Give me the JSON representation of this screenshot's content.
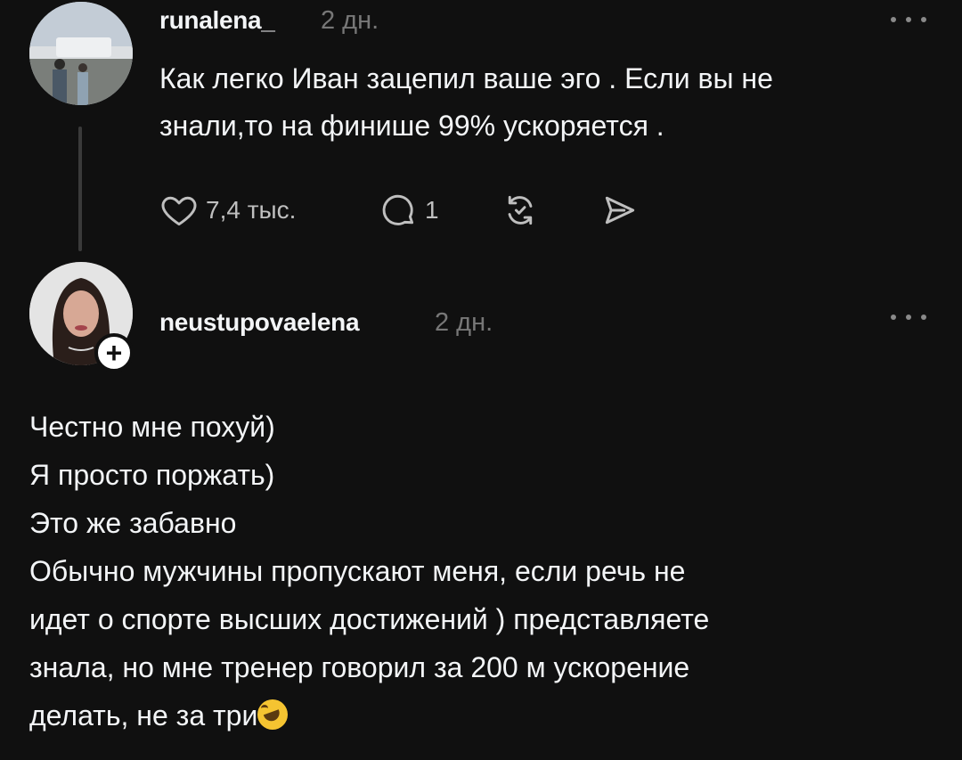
{
  "reply": {
    "username": "runalena_",
    "time": "2 дн.",
    "text_lines": [
      "Как легко Иван зацепил ваше эго . Если вы не",
      "знали,то на финише 99% ускоряется ."
    ],
    "likes": "7,4 тыс.",
    "comments": "1",
    "icons": {
      "like": "heart-icon",
      "comment": "comment-icon",
      "repost": "repost-icon",
      "share": "send-icon",
      "more": "more-icon"
    }
  },
  "post": {
    "username": "neustupovaelena",
    "time": "2 дн.",
    "follow_label": "+",
    "text_lines": [
      "Честно мне похуй)",
      "Я просто поржать)",
      "Это же забавно",
      "Обычно мужчины пропускают меня, если речь не",
      "идет о спорте высших достижений ) представляете",
      "знала, но мне тренер говорил за 200 м ускорение",
      "делать, не за три"
    ],
    "emoji": "rolling-on-floor-laughing-emoji"
  },
  "colors": {
    "background": "#101010",
    "text": "#f3f5f7",
    "secondary": "#777777",
    "icon": "#bfbfbf"
  }
}
